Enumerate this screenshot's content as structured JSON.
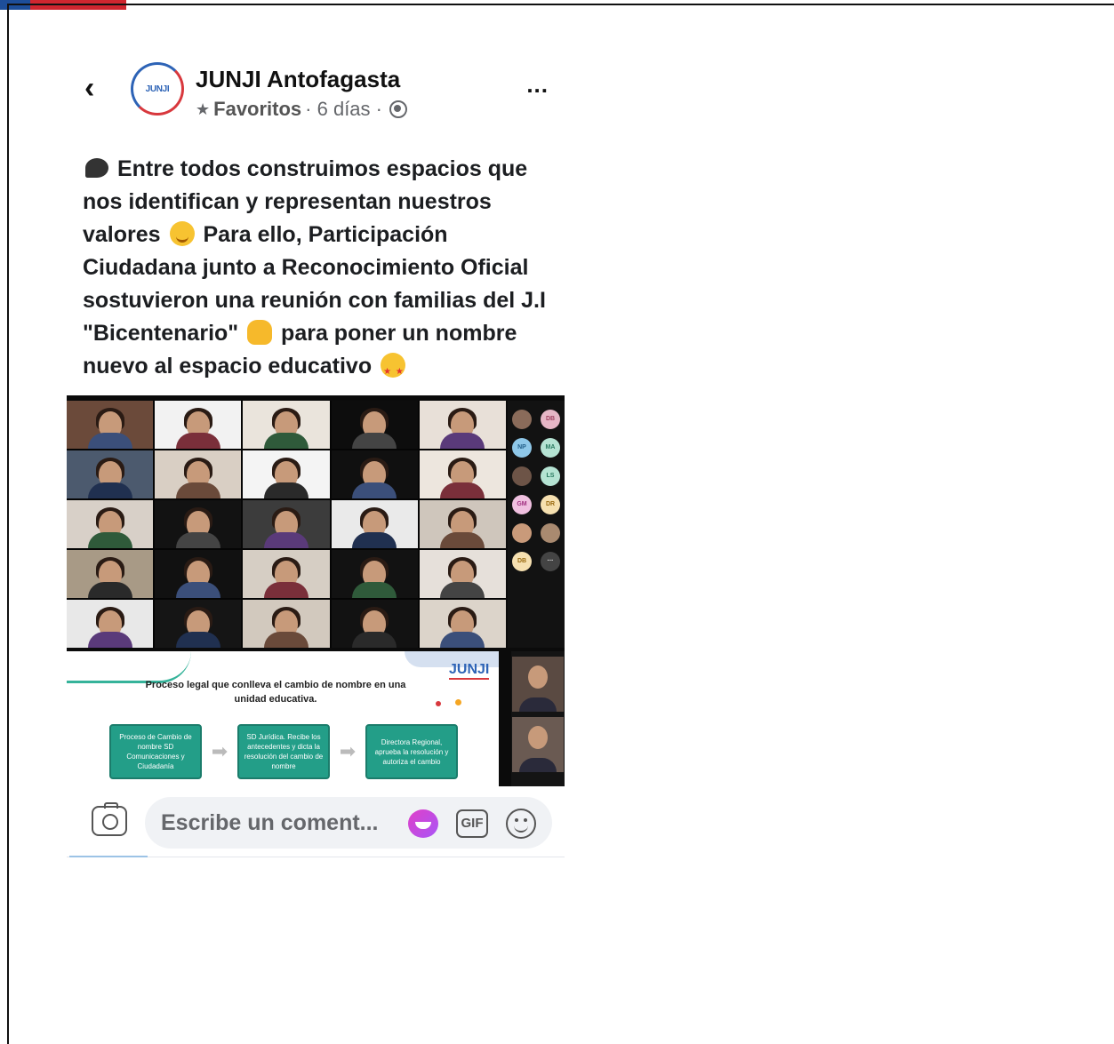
{
  "post": {
    "page_name": "JUNJI Antofagasta",
    "avatar_text": "JUNJI",
    "meta": {
      "favorites_label": "Favoritos",
      "time": "· 6 días ·"
    },
    "text": {
      "line1": "Entre todos construimos espacios que nos identifican y representan nuestros valores",
      "line2": "Para ello, Participación Ciudadana junto a Reconocimiento Oficial sostuvieron una reunión con familias del J.I \"Bicentenario\"",
      "line3": "para poner un nombre nuevo al espacio educativo"
    },
    "more_label": "..."
  },
  "media": {
    "side_avatars": [
      "DB",
      "NP",
      "MA",
      "LS",
      "GM",
      "DR",
      "DB"
    ],
    "slide": {
      "logo": "JUNJI",
      "title": "Proceso legal que conlleva el cambio de nombre en una unidad educativa.",
      "steps": [
        "Proceso de Cambio de nombre SD Comunicaciones y Ciudadanía",
        "SD Jurídica. Recibe los antecedentes y dicta la resolución del cambio de nombre",
        "Directora Regional, aprueba la resolución y autoriza el cambio"
      ]
    }
  },
  "comment": {
    "placeholder": "Escribe un coment...",
    "gif_label": "GIF"
  },
  "colors": {
    "accent_blue": "#2d63b6",
    "accent_red": "#d8383d",
    "teal": "#239e88",
    "muted_text": "#65676b"
  }
}
